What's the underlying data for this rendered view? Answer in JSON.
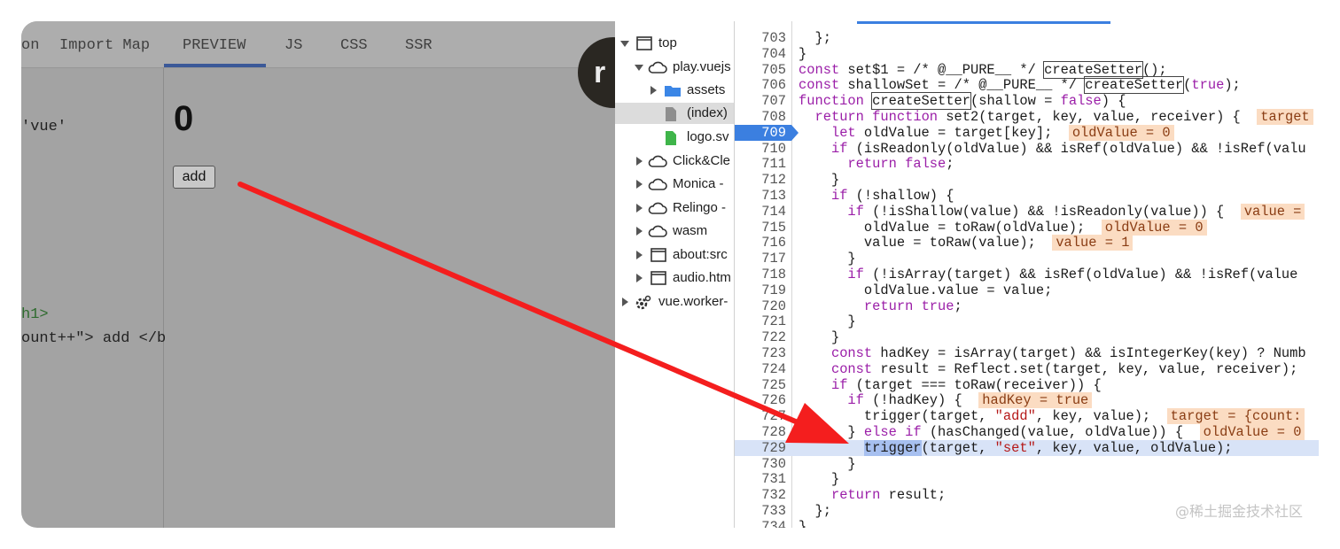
{
  "playground": {
    "tabs": [
      "on",
      "Import Map",
      "PREVIEW",
      "JS",
      "CSS",
      "SSR"
    ],
    "active_tab": "PREVIEW",
    "editor_lines": [
      "'vue'",
      "h1>",
      "ount++\"> add </b"
    ],
    "preview": {
      "count": "0",
      "add_button": "add"
    },
    "avatar_letter": "r"
  },
  "devtools": {
    "tree": [
      {
        "label": "top",
        "icon": "frame-icon",
        "expanded": true
      },
      {
        "label": "play.vuejs",
        "icon": "cloud-icon",
        "expanded": true
      },
      {
        "label": "assets",
        "icon": "folder-icon",
        "expanded": false
      },
      {
        "label": "(index)",
        "icon": "file-icon",
        "selected": true
      },
      {
        "label": "logo.sv",
        "icon": "file-icon"
      },
      {
        "label": "Click&Cle",
        "icon": "cloud-icon",
        "expanded": false
      },
      {
        "label": "Monica -",
        "icon": "cloud-icon",
        "expanded": false
      },
      {
        "label": "Relingo -",
        "icon": "cloud-icon",
        "expanded": false
      },
      {
        "label": "wasm",
        "icon": "cloud-icon",
        "expanded": false
      },
      {
        "label": "about:src",
        "icon": "frame-icon",
        "expanded": false
      },
      {
        "label": "audio.htm",
        "icon": "frame-icon",
        "expanded": false
      },
      {
        "label": "vue.worker-",
        "icon": "gear-icon",
        "expanded": false
      }
    ],
    "breakpoint_line": "709",
    "current_line": "729",
    "lines": [
      {
        "n": "703",
        "code": "  };"
      },
      {
        "n": "704",
        "code": "}"
      },
      {
        "n": "705",
        "code": "const set$1 = /* @__PURE__ */ createSetter();"
      },
      {
        "n": "706",
        "code": "const shallowSet = /* @__PURE__ */ createSetter(true);"
      },
      {
        "n": "707",
        "code": "function createSetter(shallow = false) {"
      },
      {
        "n": "708",
        "code": "  return function set2(target, key, value, receiver) {",
        "inline": "target"
      },
      {
        "n": "709",
        "code": "    let oldValue = target[key];",
        "inline": "oldValue = 0"
      },
      {
        "n": "710",
        "code": "    if (isReadonly(oldValue) && isRef(oldValue) && !isRef(valu"
      },
      {
        "n": "711",
        "code": "      return false;"
      },
      {
        "n": "712",
        "code": "    }"
      },
      {
        "n": "713",
        "code": "    if (!shallow) {"
      },
      {
        "n": "714",
        "code": "      if (!isShallow(value) && !isReadonly(value)) {",
        "inline": "value ="
      },
      {
        "n": "715",
        "code": "        oldValue = toRaw(oldValue);",
        "inline": "oldValue = 0"
      },
      {
        "n": "716",
        "code": "        value = toRaw(value);",
        "inline": "value = 1"
      },
      {
        "n": "717",
        "code": "      }"
      },
      {
        "n": "718",
        "code": "      if (!isArray(target) && isRef(oldValue) && !isRef(value"
      },
      {
        "n": "719",
        "code": "        oldValue.value = value;"
      },
      {
        "n": "720",
        "code": "        return true;"
      },
      {
        "n": "721",
        "code": "      }"
      },
      {
        "n": "722",
        "code": "    }"
      },
      {
        "n": "723",
        "code": "    const hadKey = isArray(target) && isIntegerKey(key) ? Numb"
      },
      {
        "n": "724",
        "code": "    const result = Reflect.set(target, key, value, receiver);"
      },
      {
        "n": "725",
        "code": "    if (target === toRaw(receiver)) {"
      },
      {
        "n": "726",
        "code": "      if (!hadKey) {",
        "inline": "hadKey = true"
      },
      {
        "n": "727",
        "code": "        trigger(target, \"add\", key, value);",
        "inline": "target = {count:"
      },
      {
        "n": "728",
        "code": "      } else if (hasChanged(value, oldValue)) {",
        "inline": "oldValue = 0"
      },
      {
        "n": "729",
        "code": "        trigger(target, \"set\", key, value, oldValue);"
      },
      {
        "n": "730",
        "code": "      }"
      },
      {
        "n": "731",
        "code": "    }"
      },
      {
        "n": "732",
        "code": "    return result;"
      },
      {
        "n": "733",
        "code": "  };"
      },
      {
        "n": "734",
        "code": "}"
      }
    ]
  },
  "watermark": "@稀土掘金技术社区",
  "colors": {
    "accent": "#3b7fe0",
    "arrow": "#f41e1e",
    "inline_value_bg": "#fbdcc2"
  }
}
